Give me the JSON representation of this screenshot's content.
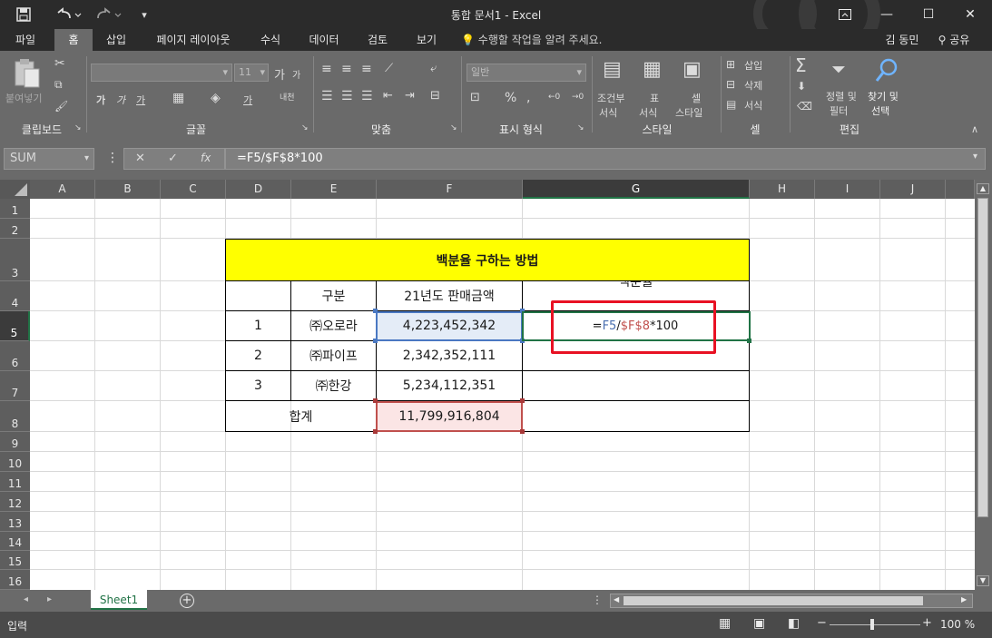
{
  "window": {
    "title": "통합 문서1 - Excel",
    "controls": {
      "restore_icon": "ribbon-display-icon",
      "minimize": "—",
      "maximize": "☐",
      "close": "✕"
    }
  },
  "qat": {
    "save_icon": "save-icon",
    "undo_icon": "undo-icon",
    "redo_icon": "redo-icon",
    "customize_icon": "customize-icon"
  },
  "tabs": [
    "파일",
    "홈",
    "삽입",
    "페이지 레이아웃",
    "수식",
    "데이터",
    "검토",
    "보기"
  ],
  "active_tab": "홈",
  "tell_me": "수행할 작업을 알려 주세요.",
  "user": "김 동민",
  "share": "공유",
  "ribbon": {
    "clipboard": {
      "label": "클립보드",
      "paste": "붙여넣기"
    },
    "font": {
      "label": "글꼴",
      "size": "11",
      "bold": "가",
      "italic": "가",
      "underline": "가",
      "grow": "가",
      "shrink": "가",
      "color_a": "가",
      "phonetic": "내천"
    },
    "alignment": {
      "label": "맞춤"
    },
    "number": {
      "label": "표시 형식",
      "format": "일반",
      "percent": "%"
    },
    "styles": {
      "label": "스타일",
      "cond_l1": "조건부",
      "cond_l2": "서식",
      "table_l1": "표",
      "table_l2": "서식",
      "cell_l1": "셀",
      "cell_l2": "스타일"
    },
    "cells": {
      "label": "셀",
      "insert": "삽입",
      "delete": "삭제",
      "format": "서식"
    },
    "editing": {
      "label": "편집",
      "sort_l1": "정렬 및",
      "sort_l2": "필터",
      "find_l1": "찾기 및",
      "find_l2": "선택"
    }
  },
  "formula_bar": {
    "name_box": "SUM",
    "cancel": "✕",
    "enter": "✓",
    "fx": "fx",
    "formula": "=F5/$F$8*100"
  },
  "columns": [
    "A",
    "B",
    "C",
    "D",
    "E",
    "F",
    "G",
    "H",
    "I",
    "J"
  ],
  "rows": [
    "1",
    "2",
    "3",
    "4",
    "5",
    "6",
    "7",
    "8",
    "9",
    "10",
    "11",
    "12",
    "13",
    "14",
    "15",
    "16"
  ],
  "table": {
    "title": "백분율 구하는 방법",
    "headers": [
      "구분",
      "21년도 판매금액",
      "백분율"
    ],
    "rows": [
      {
        "no": "1",
        "name": "㈜오로라",
        "amount": "4,223,452,342"
      },
      {
        "no": "2",
        "name": "㈜파이프",
        "amount": "2,342,352,111"
      },
      {
        "no": "3",
        "name": "㈜한강",
        "amount": "5,234,112,351"
      }
    ],
    "total_label": "합계",
    "total_amount": "11,799,916,804"
  },
  "edit_cell": {
    "eq": "=",
    "ref1": "F5",
    "slash": "/",
    "ref2": "$F$8",
    "rest": "*100"
  },
  "colors": {
    "ref1": "#4a6fb0",
    "ref2": "#c0504d",
    "accent": "#217346",
    "title_fill": "#ffff00",
    "highlight": "#e81123"
  },
  "sheet_tab": "Sheet1",
  "status": {
    "mode": "입력",
    "zoom": "100 %"
  }
}
